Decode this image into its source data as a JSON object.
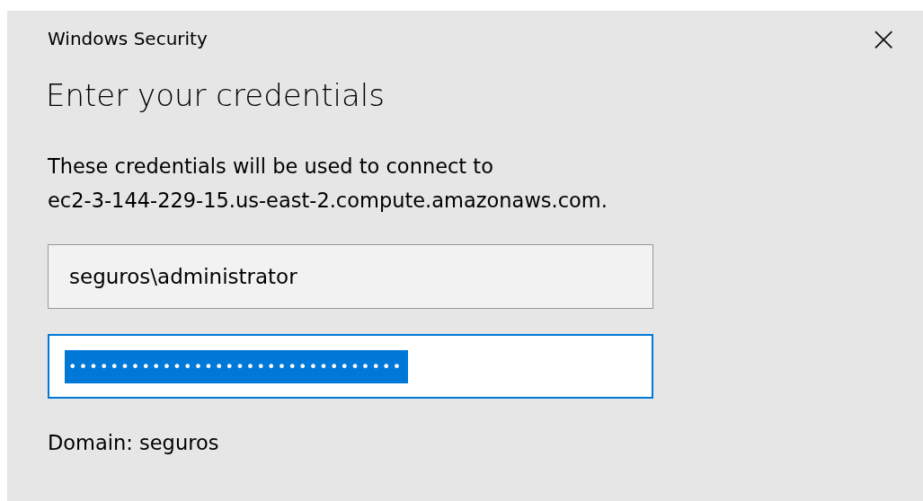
{
  "window": {
    "title": "Windows Security",
    "close": "×"
  },
  "heading": "Enter your credentials",
  "message": [
    "These credentials will be used to connect to",
    "ec2-3-144-229-15.us-east-2.compute.amazonaws.com."
  ],
  "fields": [
    {
      "kind": "text",
      "value": "seguros\\administrator",
      "focused": false,
      "selected": false
    },
    {
      "kind": "password",
      "value": "••••••••••••••••••••••••••••••••",
      "focused": true,
      "selected": true
    }
  ],
  "domain": "Domain: seguros"
}
